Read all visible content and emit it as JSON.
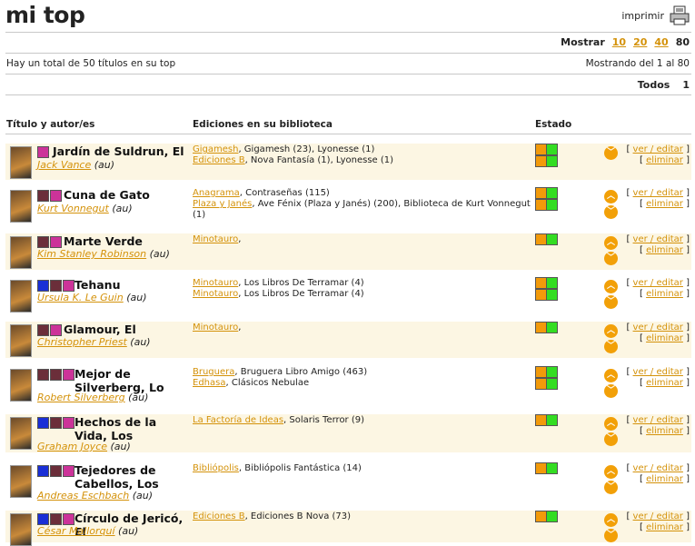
{
  "header": {
    "title": "mi top",
    "print_label": "imprimir"
  },
  "controls": {
    "mostrar_label": "Mostrar",
    "options": [
      "10",
      "20",
      "40"
    ],
    "current": "80",
    "total_text": "Hay un total de 50 títulos en su top",
    "showing_text": "Mostrando del 1 al 80",
    "todos_label": "Todos",
    "page": "1"
  },
  "columns": {
    "title": "Título y autor/es",
    "editions": "Ediciones en su biblioteca",
    "status": "Estado"
  },
  "actions": {
    "edit": "ver / editar",
    "delete": "eliminar"
  },
  "books": [
    {
      "title": "Jardín de Suldrun, El",
      "author": "Jack Vance",
      "role": "(au)",
      "editions": [
        {
          "publisher": "Gigamesh",
          "rest": ", Gigamesh (23), Lyonesse (1)"
        },
        {
          "publisher": "Ediciones B",
          "rest": ", Nova Fantasía (1), Lyonesse (1)"
        }
      ],
      "rating_colors": [
        "#cc3399"
      ],
      "status": [
        [
          "o",
          "g"
        ],
        [
          "o",
          "g"
        ]
      ],
      "arrows": [
        "down"
      ]
    },
    {
      "title": "Cuna de Gato",
      "author": "Kurt Vonnegut",
      "role": "(au)",
      "editions": [
        {
          "publisher": "Anagrama",
          "rest": ", Contraseñas (115)"
        },
        {
          "publisher": "Plaza y Janés",
          "rest": ", Ave Fénix (Plaza y Janés) (200), Biblioteca de Kurt Vonnegut (1)"
        }
      ],
      "rating_colors": [
        "#6b2e3a",
        "#cc3399"
      ],
      "status": [
        [
          "o",
          "g"
        ],
        [
          "o",
          "g"
        ]
      ],
      "arrows": [
        "up",
        "down"
      ]
    },
    {
      "title": "Marte Verde",
      "author": "Kim Stanley Robinson",
      "role": "(au)",
      "editions": [
        {
          "publisher": "Minotauro",
          "rest": ","
        }
      ],
      "rating_colors": [
        "#6b2e3a",
        "#cc3399"
      ],
      "status": [
        [
          "o",
          "g"
        ]
      ],
      "arrows": [
        "up",
        "down"
      ]
    },
    {
      "title": "Tehanu",
      "author": "Ursula K. Le Guin",
      "role": "(au)",
      "editions": [
        {
          "publisher": "Minotauro",
          "rest": ", Los Libros De Terramar (4)"
        },
        {
          "publisher": "Minotauro",
          "rest": ", Los Libros De Terramar (4)"
        }
      ],
      "rating_colors": [
        "#1a2fd6",
        "#6b2e3a",
        "#cc3399"
      ],
      "status": [
        [
          "o",
          "g"
        ],
        [
          "o",
          "g"
        ]
      ],
      "arrows": [
        "up",
        "down"
      ]
    },
    {
      "title": "Glamour, El",
      "author": "Christopher Priest",
      "role": "(au)",
      "editions": [
        {
          "publisher": "Minotauro",
          "rest": ","
        }
      ],
      "rating_colors": [
        "#6b2e3a",
        "#cc3399"
      ],
      "status": [
        [
          "o",
          "g"
        ]
      ],
      "arrows": [
        "up",
        "down"
      ]
    },
    {
      "title": "Mejor de Silverberg, Lo",
      "author": "Robert Silverberg",
      "role": "(au)",
      "editions": [
        {
          "publisher": "Bruguera",
          "rest": ", Bruguera Libro Amigo (463)"
        },
        {
          "publisher": "Edhasa",
          "rest": ", Clásicos Nebulae"
        }
      ],
      "rating_colors": [
        "#6b2e3a",
        "#6b2e3a",
        "#cc3399"
      ],
      "status": [
        [
          "o",
          "g"
        ],
        [
          "o",
          "g"
        ]
      ],
      "arrows": [
        "up",
        "down"
      ]
    },
    {
      "title": "Hechos de la Vida, Los",
      "author": "Graham Joyce",
      "role": "(au)",
      "editions": [
        {
          "publisher": "La Factoría de Ideas",
          "rest": ", Solaris Terror (9)"
        }
      ],
      "rating_colors": [
        "#1a2fd6",
        "#6b2e3a",
        "#cc3399"
      ],
      "status": [
        [
          "o",
          "g"
        ]
      ],
      "arrows": [
        "up",
        "down"
      ]
    },
    {
      "title": "Tejedores de Cabellos, Los",
      "author": "Andreas Eschbach",
      "role": "(au)",
      "editions": [
        {
          "publisher": "Bibliópolis",
          "rest": ", Bibliópolis Fantástica (14)"
        }
      ],
      "rating_colors": [
        "#1a2fd6",
        "#6b2e3a",
        "#cc3399"
      ],
      "status": [
        [
          "o",
          "g"
        ]
      ],
      "arrows": [
        "up",
        "down"
      ]
    },
    {
      "title": "Círculo de Jericó, El",
      "author": "César Mallorquí",
      "role": "(au)",
      "editions": [
        {
          "publisher": "Ediciones B",
          "rest": ", Ediciones B Nova (73)"
        }
      ],
      "rating_colors": [
        "#1a2fd6",
        "#6b2e3a",
        "#cc3399"
      ],
      "status": [
        [
          "o",
          "g"
        ]
      ],
      "arrows": [
        "up",
        "down"
      ]
    }
  ]
}
